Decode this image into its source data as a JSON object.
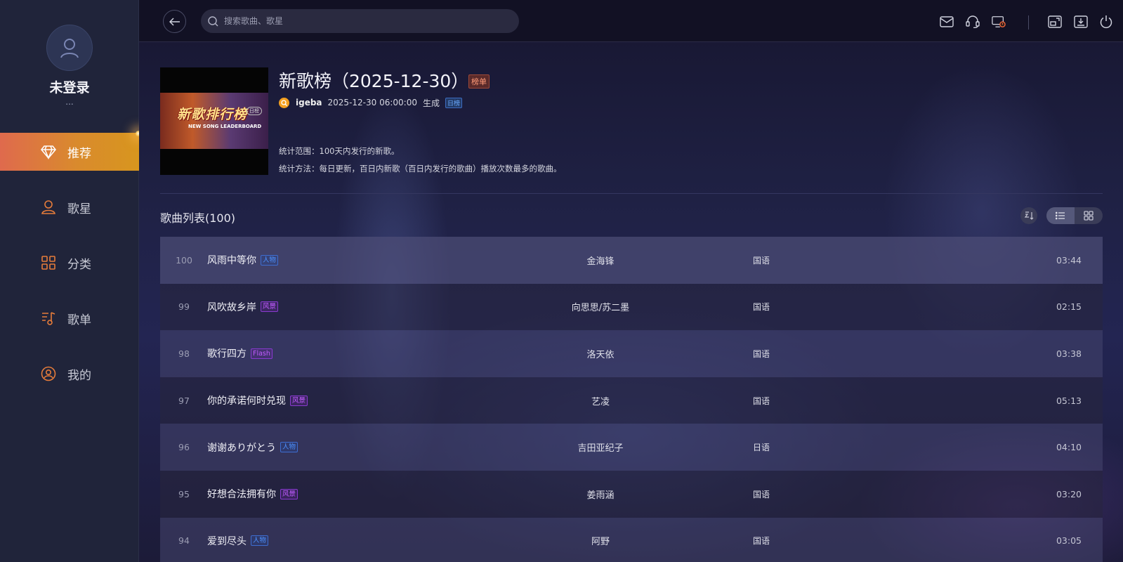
{
  "user": {
    "name": "未登录",
    "sub": "..."
  },
  "nav": [
    {
      "label": "推荐",
      "icon": "diamond-icon",
      "active": true
    },
    {
      "label": "歌星",
      "icon": "user-icon",
      "active": false
    },
    {
      "label": "分类",
      "icon": "grid-icon",
      "active": false
    },
    {
      "label": "歌单",
      "icon": "music-list-icon",
      "active": false
    },
    {
      "label": "我的",
      "icon": "profile-icon",
      "active": false
    }
  ],
  "search": {
    "placeholder": "搜索歌曲、歌星"
  },
  "chart": {
    "title": "新歌榜（2025-12-30）",
    "badge": "榜单",
    "author": "igeba",
    "datetime": "2025-12-30 06:00:00",
    "generated": "生成",
    "period_tag": "日榜",
    "cover": {
      "title": "新歌排行榜",
      "subtitle": "NEW SONG LEADERBOARD",
      "tag": "日榜"
    },
    "desc_range": "统计范围：100天内发行的新歌。",
    "desc_method": "统计方法：每日更新，百日内新歌（百日内发行的歌曲）播放次数最多的歌曲。"
  },
  "list": {
    "title": "歌曲列表(100)",
    "songs": [
      {
        "rank": "100",
        "name": "风雨中等你",
        "tag": "人物",
        "tag_color": "blue",
        "artist": "金海锋",
        "lang": "国语",
        "duration": "03:44"
      },
      {
        "rank": "99",
        "name": "风吹故乡岸",
        "tag": "风景",
        "tag_color": "purple",
        "artist": "向思思/苏二墨",
        "lang": "国语",
        "duration": "02:15"
      },
      {
        "rank": "98",
        "name": "歌行四方",
        "tag": "Flash",
        "tag_color": "purple",
        "artist": "洛天依",
        "lang": "国语",
        "duration": "03:38"
      },
      {
        "rank": "97",
        "name": "你的承诺何时兑现",
        "tag": "风景",
        "tag_color": "purple",
        "artist": "艺凌",
        "lang": "国语",
        "duration": "05:13"
      },
      {
        "rank": "96",
        "name": "谢谢ありがとう",
        "tag": "人物",
        "tag_color": "blue",
        "artist": "吉田亚纪子",
        "lang": "日语",
        "duration": "04:10"
      },
      {
        "rank": "95",
        "name": "好想合法拥有你",
        "tag": "风景",
        "tag_color": "purple",
        "artist": "姜雨涵",
        "lang": "国语",
        "duration": "03:20"
      },
      {
        "rank": "94",
        "name": "爱到尽头",
        "tag": "人物",
        "tag_color": "blue",
        "artist": "阿野",
        "lang": "国语",
        "duration": "03:05"
      }
    ]
  },
  "toolbar_icons": [
    "mail-icon",
    "headset-icon",
    "screen-alert-icon",
    "picture-in-picture-icon",
    "download-icon",
    "power-icon"
  ]
}
